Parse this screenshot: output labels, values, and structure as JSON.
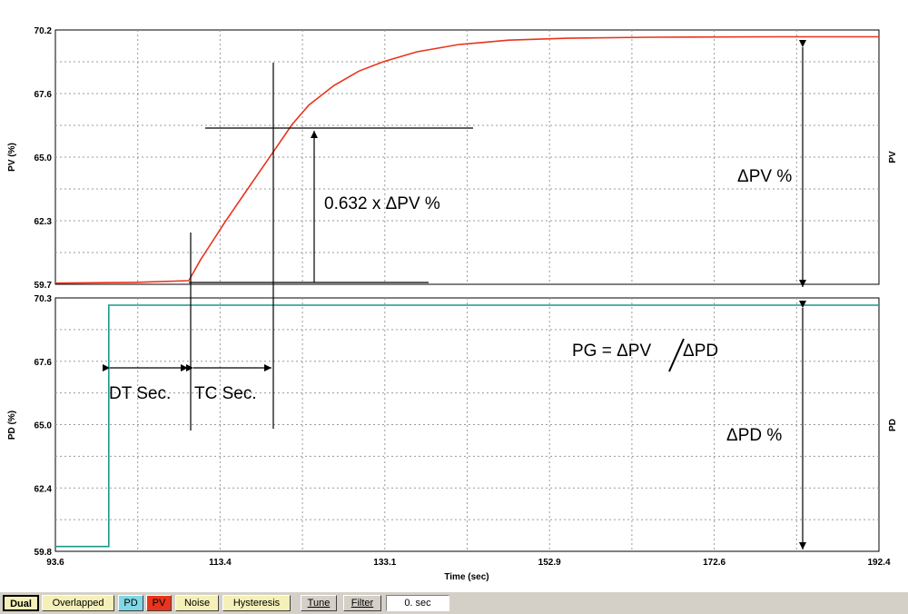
{
  "chart_data": [
    {
      "type": "line",
      "panel": "top",
      "ylabel": "PV (%)",
      "right_label": "PV",
      "xlabel": "",
      "xlim": [
        93.6,
        192.4
      ],
      "ylim": [
        59.7,
        70.2
      ],
      "yticks": [
        "70.2",
        "67.6",
        "65.0",
        "62.3",
        "59.7"
      ],
      "grid": true,
      "series": [
        {
          "color": "#e8341c",
          "x": [
            93.6,
            103.0,
            109.6,
            111.0,
            112.5,
            114.0,
            116.0,
            118.0,
            120.0,
            122.0,
            124.0,
            127.0,
            130.0,
            133.0,
            137.0,
            142.0,
            148.0,
            155.0,
            165.0,
            180.0,
            192.4
          ],
          "y": [
            59.75,
            59.78,
            59.85,
            60.7,
            61.5,
            62.3,
            63.3,
            64.3,
            65.3,
            66.3,
            67.1,
            67.9,
            68.5,
            68.9,
            69.3,
            69.6,
            69.78,
            69.86,
            69.9,
            69.92,
            69.92
          ]
        }
      ],
      "annotations": [
        "0.632 x ΔPV %",
        "ΔPV %"
      ]
    },
    {
      "type": "line",
      "panel": "bottom",
      "ylabel": "PD (%)",
      "right_label": "PD",
      "xlabel": "Time (sec)",
      "xlim": [
        93.6,
        192.4
      ],
      "ylim": [
        59.8,
        70.3
      ],
      "yticks": [
        "70.3",
        "67.6",
        "65.0",
        "62.4",
        "59.8"
      ],
      "xticks": [
        "93.6",
        "113.4",
        "133.1",
        "152.9",
        "172.6",
        "192.4"
      ],
      "grid": true,
      "series": [
        {
          "color": "#1a9a8a",
          "x": [
            93.6,
            100.0,
            100.0,
            192.4
          ],
          "y": [
            60.0,
            60.0,
            70.0,
            70.0
          ]
        }
      ],
      "annotations": [
        "PG = ΔPV",
        "ΔPD",
        "DT Sec.",
        "TC Sec.",
        "ΔPD %"
      ]
    }
  ],
  "toolbar": {
    "dual": "Dual",
    "overlapped": "Overlapped",
    "pd": "PD",
    "pv": "PV",
    "noise": "Noise",
    "hysteresis": "Hysteresis",
    "tune": "Tune",
    "filter": "Filter",
    "filter_value": "0. sec",
    "colors": {
      "pd": "#7fd8e6",
      "pv": "#e8341c",
      "yellow": "#f4f0b8",
      "panel": "#d4d0c8"
    }
  }
}
